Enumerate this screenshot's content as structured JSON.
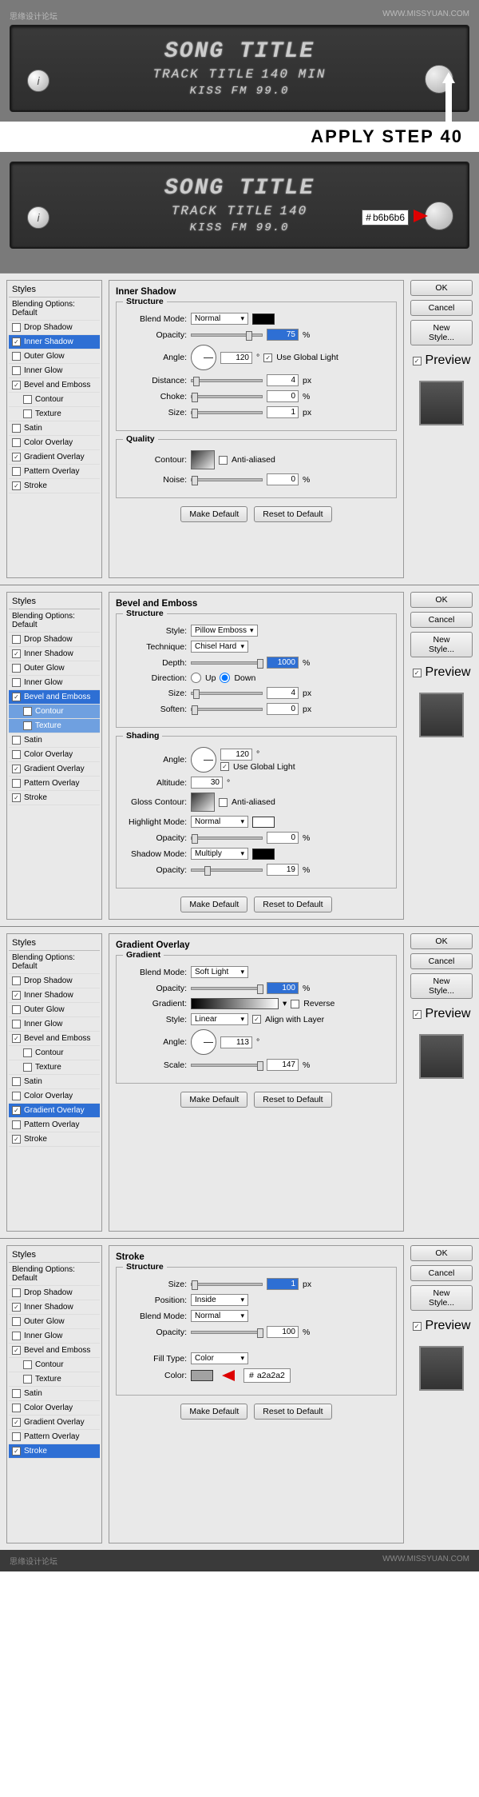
{
  "header": {
    "left_text": "思缘设计论坛",
    "right_text": "WWW.MISSYUAN.COM"
  },
  "display1": {
    "line1": "SONG TITLE",
    "line2_label": "TRACK TITLE",
    "line2_value": "140 MIN",
    "line3": "KISS FM 99.0",
    "info": "i"
  },
  "apply_label": "APPLY STEP 40",
  "display2": {
    "line1": "SONG TITLE",
    "line2_label": "TRACK TITLE",
    "line2_value": "140",
    "line3": "KISS FM 99.0",
    "color_prefix": "#",
    "color_value": "b6b6b6",
    "info": "i"
  },
  "styles_header": "Styles",
  "blending_default": "Blending Options: Default",
  "fx": {
    "drop_shadow": "Drop Shadow",
    "inner_shadow": "Inner Shadow",
    "outer_glow": "Outer Glow",
    "inner_glow": "Inner Glow",
    "bevel": "Bevel and Emboss",
    "contour": "Contour",
    "texture": "Texture",
    "satin": "Satin",
    "color_overlay": "Color Overlay",
    "gradient_overlay": "Gradient Overlay",
    "pattern_overlay": "Pattern Overlay",
    "stroke": "Stroke"
  },
  "buttons": {
    "ok": "OK",
    "cancel": "Cancel",
    "new_style": "New Style...",
    "preview": "Preview",
    "make_default": "Make Default",
    "reset_default": "Reset to Default"
  },
  "labels": {
    "structure": "Structure",
    "quality": "Quality",
    "shading": "Shading",
    "gradient": "Gradient",
    "blend_mode": "Blend Mode:",
    "opacity": "Opacity:",
    "angle": "Angle:",
    "distance": "Distance:",
    "choke": "Choke:",
    "size": "Size:",
    "contour": "Contour:",
    "noise": "Noise:",
    "anti_aliased": "Anti-aliased",
    "use_global": "Use Global Light",
    "style": "Style:",
    "technique": "Technique:",
    "depth": "Depth:",
    "direction": "Direction:",
    "up": "Up",
    "down": "Down",
    "soften": "Soften:",
    "altitude": "Altitude:",
    "gloss_contour": "Gloss Contour:",
    "highlight_mode": "Highlight Mode:",
    "shadow_mode": "Shadow Mode:",
    "gradient_lbl": "Gradient:",
    "reverse": "Reverse",
    "align": "Align with Layer",
    "scale": "Scale:",
    "position": "Position:",
    "fill_type": "Fill Type:",
    "color": "Color:"
  },
  "panel1": {
    "title": "Inner Shadow",
    "blend_mode": "Normal",
    "opacity": "75",
    "angle": "120",
    "distance": "4",
    "choke": "0",
    "size": "1",
    "noise": "0"
  },
  "panel2": {
    "title": "Bevel and Emboss",
    "style": "Pillow Emboss",
    "technique": "Chisel Hard",
    "depth": "1000",
    "size": "4",
    "soften": "0",
    "angle": "120",
    "altitude": "30",
    "highlight_mode": "Normal",
    "highlight_opacity": "0",
    "shadow_mode": "Multiply",
    "shadow_opacity": "19"
  },
  "panel3": {
    "title": "Gradient Overlay",
    "blend_mode": "Soft Light",
    "opacity": "100",
    "style": "Linear",
    "angle": "113",
    "scale": "147"
  },
  "panel4": {
    "title": "Stroke",
    "size": "1",
    "position": "Inside",
    "blend_mode": "Normal",
    "opacity": "100",
    "fill_type": "Color",
    "color_prefix": "#",
    "color_value": "a2a2a2"
  },
  "units": {
    "pct": "%",
    "px": "px",
    "deg": "°"
  },
  "footer": {
    "left": "思缘设计论坛",
    "right": "WWW.MISSYUAN.COM"
  }
}
